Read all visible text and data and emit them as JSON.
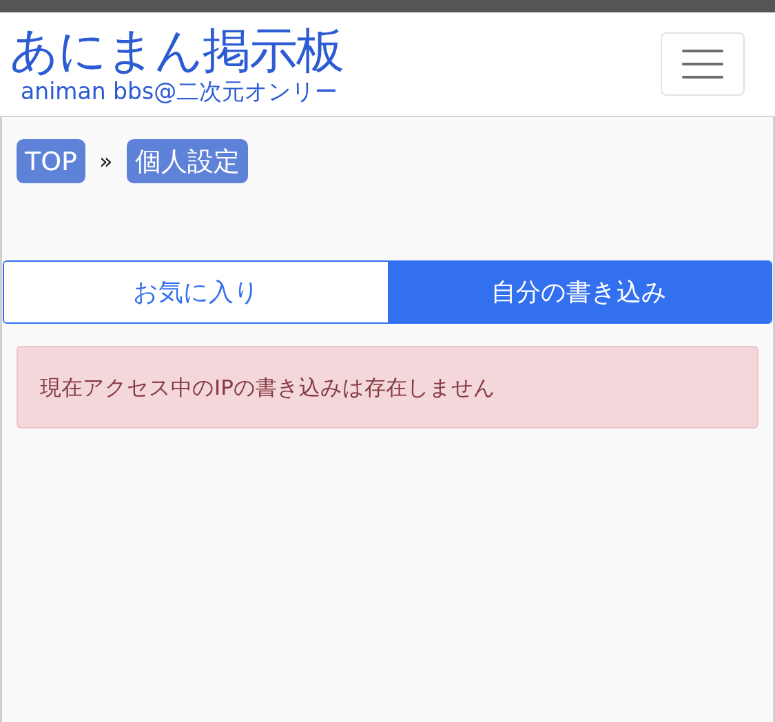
{
  "header": {
    "logo_title": "あにまん掲示板",
    "logo_subtitle": "animan bbs@二次元オンリー"
  },
  "breadcrumb": {
    "items": [
      "TOP",
      "個人設定"
    ],
    "separator": "»"
  },
  "tabs": [
    {
      "label": "お気に入り",
      "selected": false
    },
    {
      "label": "自分の書き込み",
      "selected": true
    }
  ],
  "alert": {
    "message": "現在アクセス中のIPの書き込みは存在しません"
  }
}
